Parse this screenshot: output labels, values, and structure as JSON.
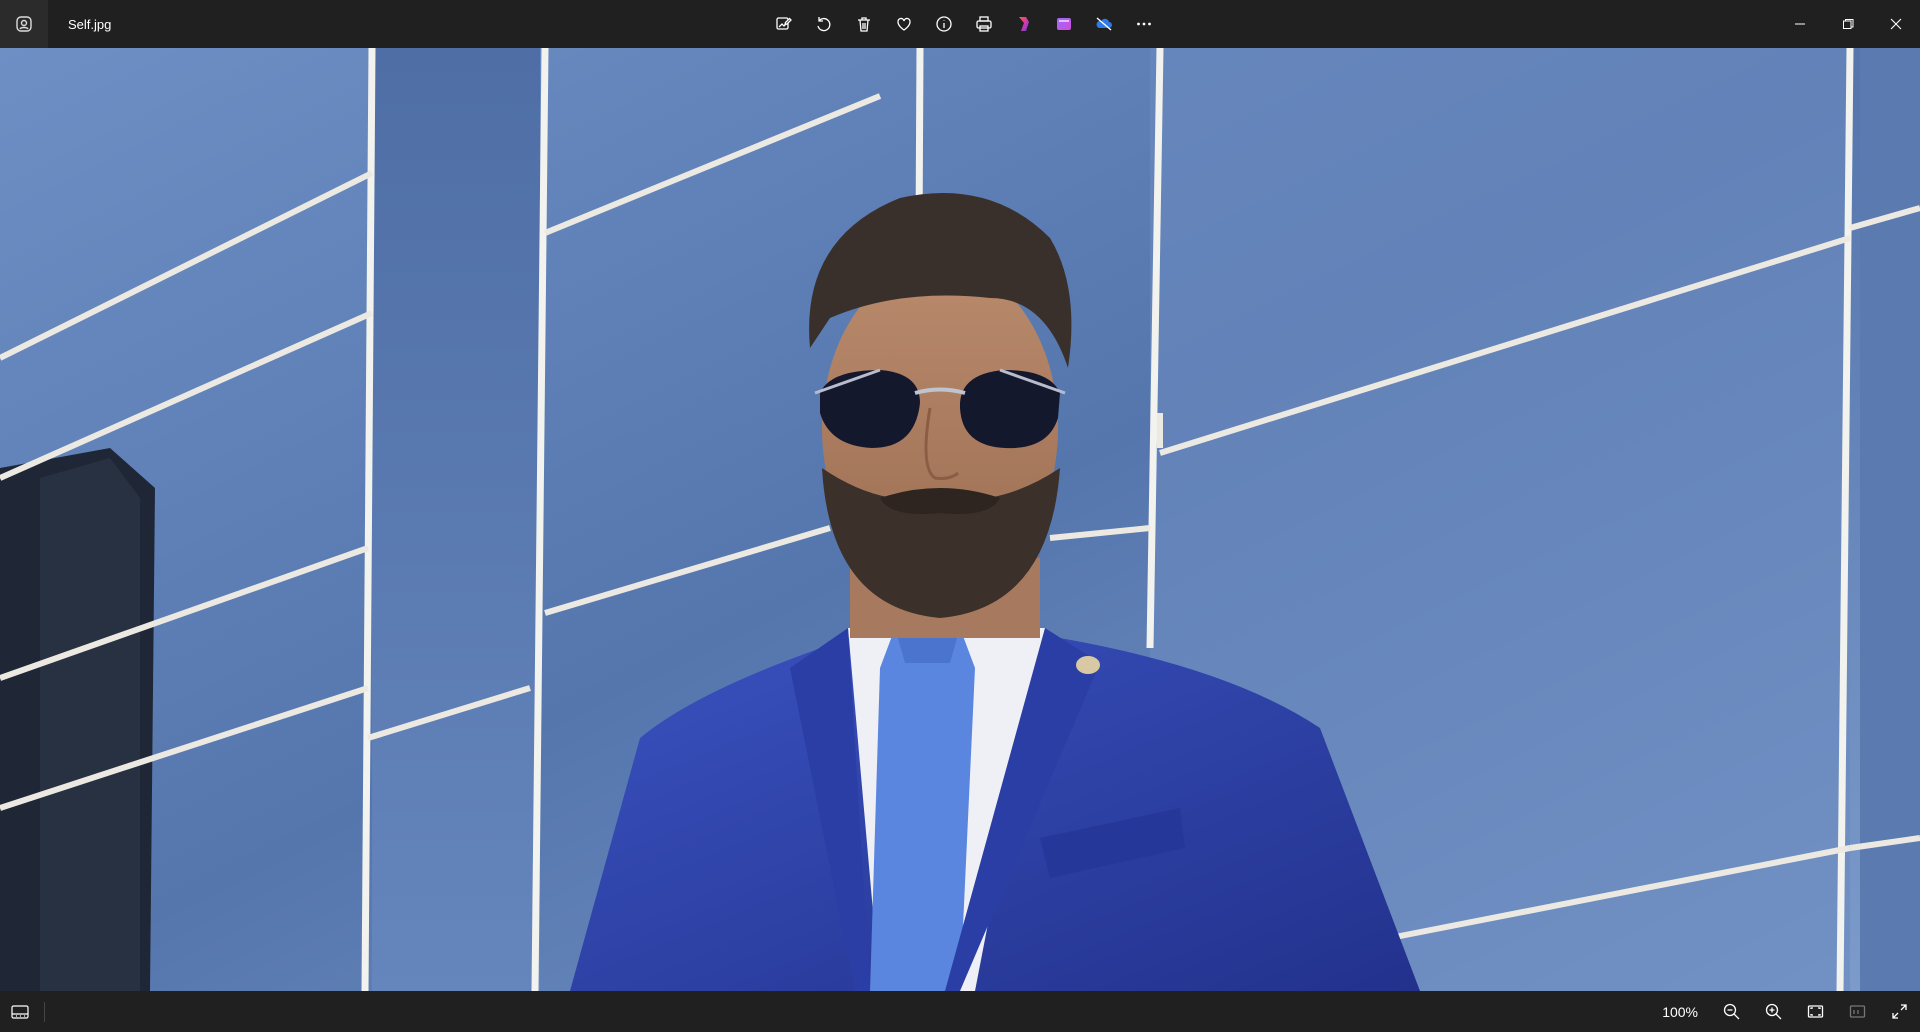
{
  "window": {
    "file_name": "Self.jpg"
  },
  "toolbar": {
    "items": [
      {
        "icon": "edit-image-icon"
      },
      {
        "icon": "rotate-icon"
      },
      {
        "icon": "delete-icon"
      },
      {
        "icon": "favorite-icon"
      },
      {
        "icon": "info-icon"
      },
      {
        "icon": "print-icon"
      },
      {
        "icon": "clipchamp-icon"
      },
      {
        "icon": "video-editor-icon"
      },
      {
        "icon": "onedrive-icon"
      },
      {
        "icon": "more-options-icon"
      }
    ]
  },
  "window_controls": {
    "items": [
      {
        "icon": "minimize-icon"
      },
      {
        "icon": "maximize-icon"
      },
      {
        "icon": "close-icon"
      }
    ]
  },
  "status_bar": {
    "zoom_level": "100%",
    "items": [
      {
        "icon": "zoom-out-icon"
      },
      {
        "icon": "zoom-in-icon"
      },
      {
        "icon": "fit-to-window-icon"
      },
      {
        "icon": "actual-size-icon"
      },
      {
        "icon": "fullscreen-icon"
      }
    ]
  },
  "colors": {
    "chrome": "#202020",
    "accent_sky": "#5b7bb0",
    "suit": "#2f43a8"
  }
}
